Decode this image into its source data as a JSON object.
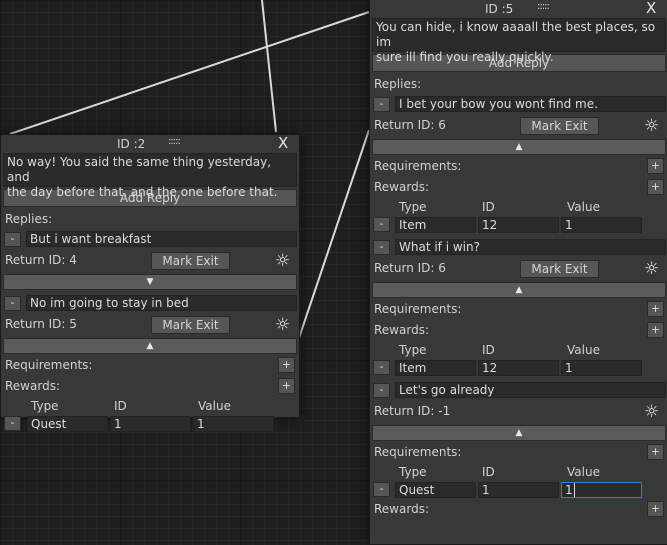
{
  "node_left": {
    "id_label": "ID :2",
    "drag_glyph": ":::::",
    "close": "X",
    "text": "No way! You said the same thing yesterday, and\nthe day before that, and the one before that.",
    "add_reply": "Add Reply",
    "replies_label": "Replies:",
    "replies": [
      {
        "minus": "-",
        "text": "But i want breakfast",
        "return_id": "Return ID: 4",
        "mark_exit": "Mark Exit",
        "fold": "▼"
      },
      {
        "minus": "-",
        "text": "No im going to stay in bed",
        "return_id": "Return ID: 5",
        "mark_exit": "Mark Exit",
        "fold": "▲",
        "requirements_label": "Requirements:",
        "rewards_label": "Rewards:",
        "plus": "+",
        "columns": [
          "Type",
          "ID",
          "Value"
        ],
        "rewards": [
          {
            "minus": "-",
            "type": "Quest",
            "id": "1",
            "value": "1"
          }
        ]
      }
    ]
  },
  "node_right": {
    "id_label": "ID :5",
    "drag_glyph": ":::::",
    "close": "X",
    "text": "You can hide, i know  aaaall the best places, so im\nsure ill find you really quickly.",
    "add_reply": "Add Reply",
    "replies_label": "Replies:",
    "replies": [
      {
        "minus": "-",
        "text": "I bet your bow you wont find me.",
        "return_id": "Return ID: 6",
        "mark_exit": "Mark Exit",
        "fold": "▲",
        "requirements_label": "Requirements:",
        "rewards_label": "Rewards:",
        "plus": "+",
        "columns": [
          "Type",
          "ID",
          "Value"
        ],
        "rewards": [
          {
            "minus": "-",
            "type": "Item",
            "id": "12",
            "value": "1"
          }
        ]
      },
      {
        "minus": "-",
        "text": "What if i win?",
        "return_id": "Return ID: 6",
        "mark_exit": "Mark Exit",
        "fold": "▲",
        "requirements_label": "Requirements:",
        "rewards_label": "Rewards:",
        "plus": "+",
        "columns": [
          "Type",
          "ID",
          "Value"
        ],
        "rewards": [
          {
            "minus": "-",
            "type": "Item",
            "id": "12",
            "value": "1"
          }
        ]
      },
      {
        "minus": "-",
        "text": "Let's go already",
        "return_id": "Return ID: -1",
        "fold": "▲",
        "requirements_label": "Requirements:",
        "rewards_label": "Rewards:",
        "plus": "+",
        "columns": [
          "Type",
          "ID",
          "Value"
        ],
        "requirements": [
          {
            "minus": "-",
            "type": "Quest",
            "id": "1",
            "value": "1"
          }
        ]
      }
    ]
  },
  "icons": {
    "exit_toggle": "sun-icon",
    "fold_open": "triangle-up-icon",
    "fold_closed": "triangle-down-icon"
  },
  "colors": {
    "canvas": "#1e1e1e",
    "node": "#383838",
    "field": "#2a2a2a",
    "button": "#565656",
    "link": "#d8d8d8",
    "focus": "#3a7bd5"
  }
}
